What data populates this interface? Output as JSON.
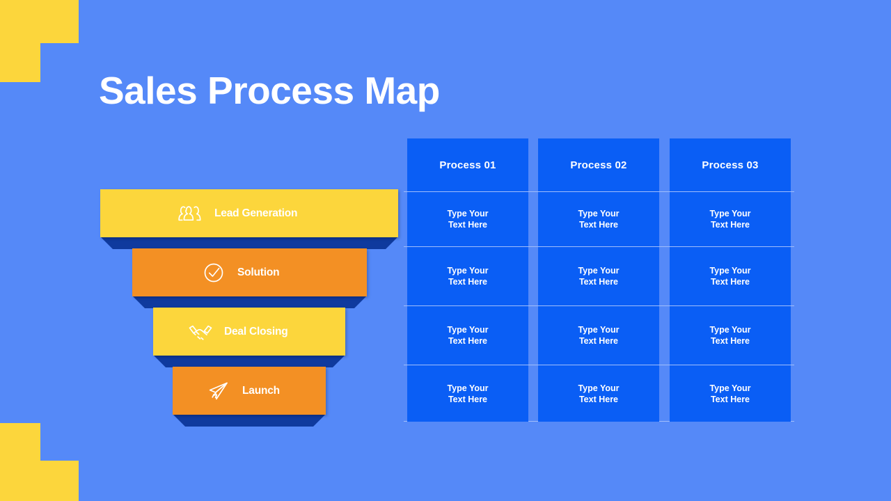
{
  "slide": {
    "title": "Sales Process Map",
    "background_color": "#5589f8",
    "card_color": "#0a5ef5",
    "accent_yellow": "#fcd63c",
    "accent_orange": "#f39024",
    "shadow_navy": "#0f3a9e"
  },
  "funnel": {
    "stages": [
      {
        "label": "Lead Generation",
        "icon": "users-group-icon",
        "color": "#fcd63c"
      },
      {
        "label": "Solution",
        "icon": "check-circle-icon",
        "color": "#f39024"
      },
      {
        "label": "Deal Closing",
        "icon": "handshake-icon",
        "color": "#fcd63c"
      },
      {
        "label": "Launch",
        "icon": "paper-plane-icon",
        "color": "#f39024"
      }
    ]
  },
  "matrix": {
    "headers": [
      "Process 01",
      "Process 02",
      "Process 03"
    ],
    "rows": [
      [
        {
          "line1": "Type Your",
          "line2": "Text Here"
        },
        {
          "line1": "Type Your",
          "line2": "Text Here"
        },
        {
          "line1": "Type Your",
          "line2": "Text Here"
        }
      ],
      [
        {
          "line1": "Type Your",
          "line2": "Text Here"
        },
        {
          "line1": "Type Your",
          "line2": "Text Here"
        },
        {
          "line1": "Type Your",
          "line2": "Text Here"
        }
      ],
      [
        {
          "line1": "Type Your",
          "line2": "Text Here"
        },
        {
          "line1": "Type Your",
          "line2": "Text Here"
        },
        {
          "line1": "Type Your",
          "line2": "Text Here"
        }
      ],
      [
        {
          "line1": "Type Your",
          "line2": "Text Here"
        },
        {
          "line1": "Type Your",
          "line2": "Text Here"
        },
        {
          "line1": "Type Your",
          "line2": "Text Here"
        }
      ]
    ]
  }
}
